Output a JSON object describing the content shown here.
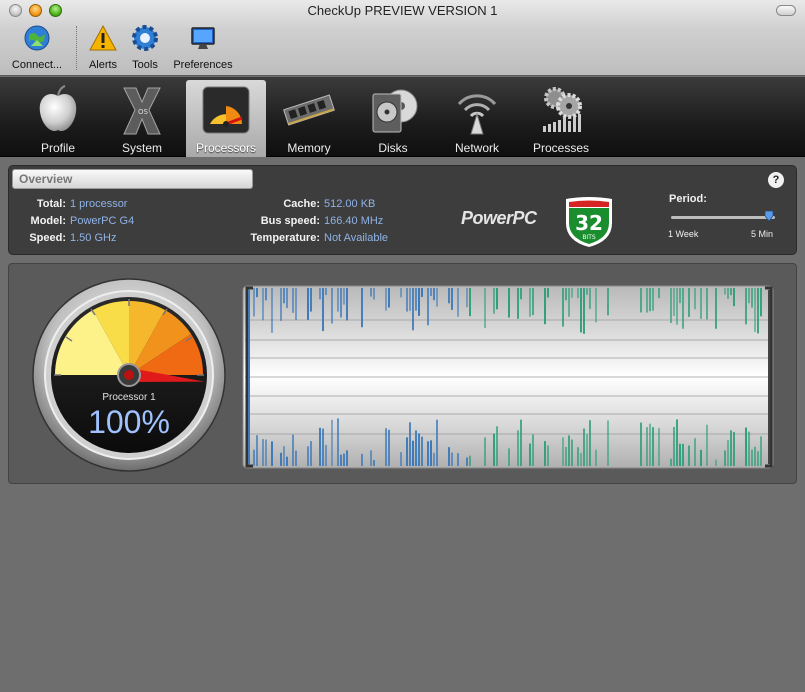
{
  "window": {
    "title": "CheckUp PREVIEW VERSION 1"
  },
  "toolbar": {
    "items": [
      {
        "label": "Connect...",
        "icon": "globe-connect-icon"
      },
      {
        "label": "Alerts",
        "icon": "warning-icon"
      },
      {
        "label": "Tools",
        "icon": "gear-icon"
      },
      {
        "label": "Preferences",
        "icon": "monitor-icon"
      }
    ]
  },
  "tabs": [
    {
      "label": "Profile",
      "icon": "apple-icon"
    },
    {
      "label": "System",
      "icon": "os-x-icon"
    },
    {
      "label": "Processors",
      "icon": "speedometer-icon",
      "active": true
    },
    {
      "label": "Memory",
      "icon": "ram-module-icon"
    },
    {
      "label": "Disks",
      "icon": "hard-disk-icon"
    },
    {
      "label": "Network",
      "icon": "wifi-antenna-icon"
    },
    {
      "label": "Processes",
      "icon": "gears-icon"
    }
  ],
  "overview": {
    "title": "Overview",
    "help": "?",
    "left": [
      {
        "key": "Total:",
        "value": "1 processor"
      },
      {
        "key": "Model:",
        "value": "PowerPC G4"
      },
      {
        "key": "Speed:",
        "value": "1.50 GHz"
      }
    ],
    "right": [
      {
        "key": "Cache:",
        "value": "512.00 KB"
      },
      {
        "key": "Bus speed:",
        "value": "166.40 MHz"
      },
      {
        "key": "Temperature:",
        "value": "Not Available"
      }
    ],
    "brand": "PowerPC",
    "bits_number": "32",
    "bits_label": "BITS",
    "period": {
      "label": "Period:",
      "min_label": "1 Week",
      "max_label": "5 Min",
      "value_fraction": 1.0
    }
  },
  "processor": {
    "name": "Processor 1",
    "usage_text": "100%",
    "usage": 1.0
  },
  "colors": {
    "link_value": "#8fb3e6",
    "history_blue": "#3d79b8",
    "history_green": "#2e9e7a"
  }
}
